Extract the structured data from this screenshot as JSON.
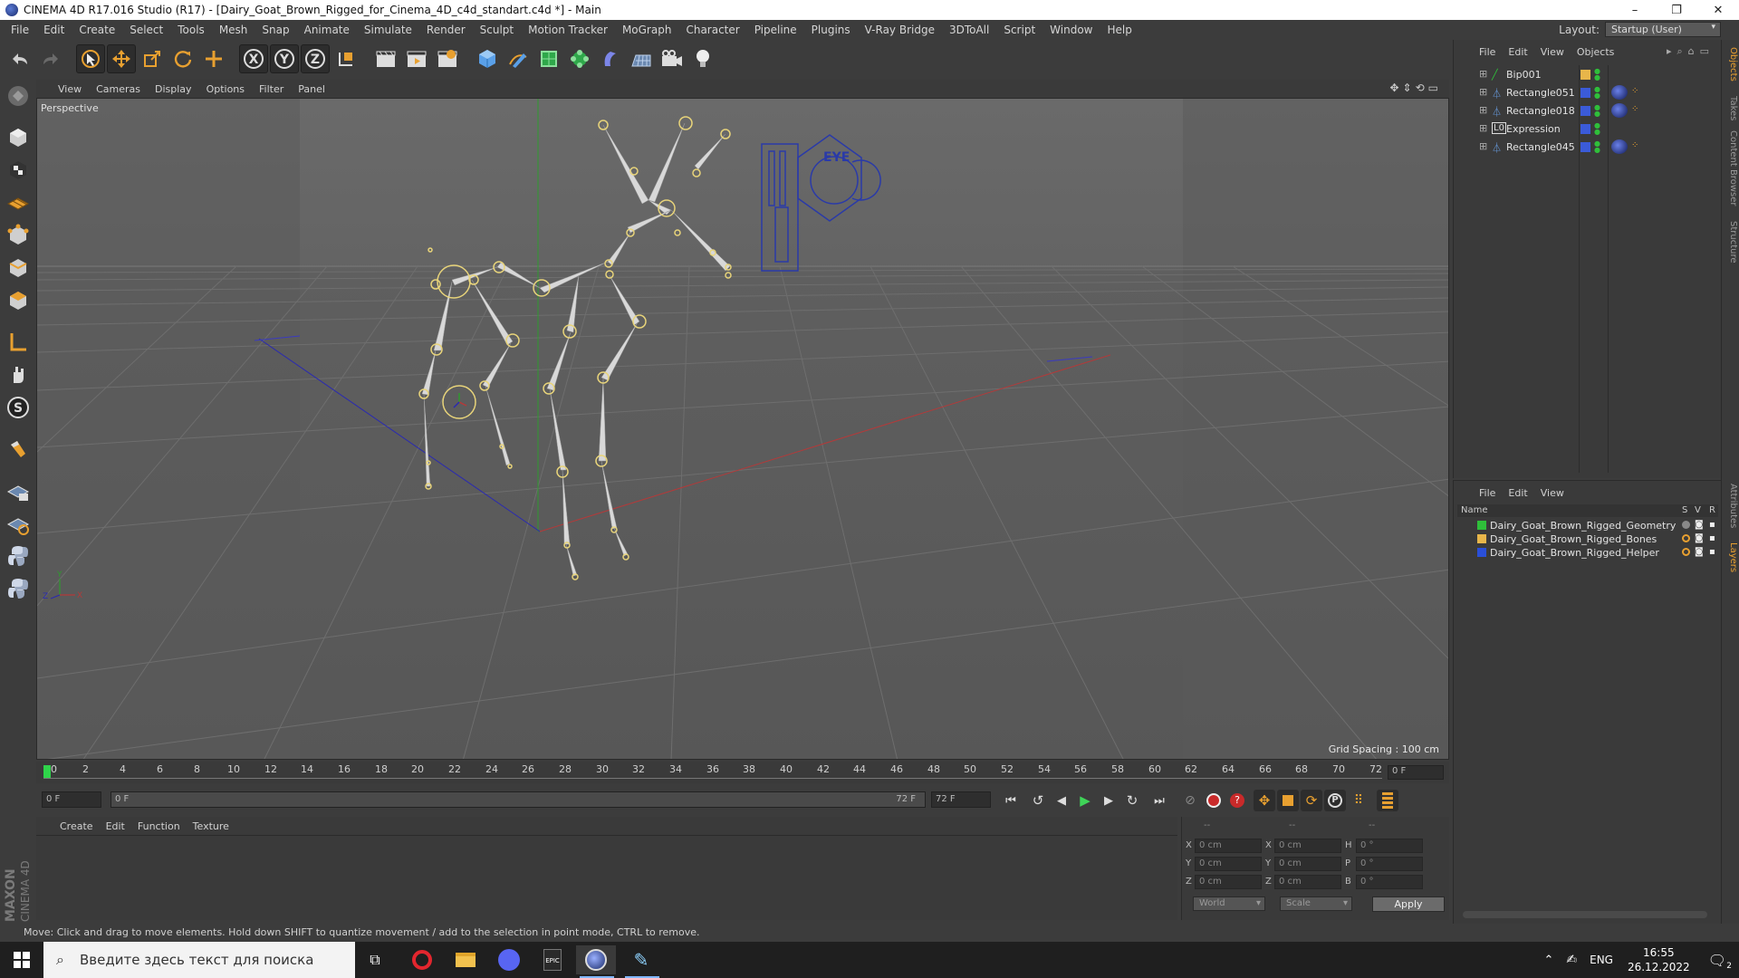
{
  "window": {
    "title": "CINEMA 4D R17.016 Studio (R17) - [Dairy_Goat_Brown_Rigged_for_Cinema_4D_c4d_standart.c4d *] - Main",
    "controls": [
      "–",
      "❐",
      "✕"
    ]
  },
  "menu": [
    "File",
    "Edit",
    "Create",
    "Select",
    "Tools",
    "Mesh",
    "Snap",
    "Animate",
    "Simulate",
    "Render",
    "Sculpt",
    "Motion Tracker",
    "MoGraph",
    "Character",
    "Pipeline",
    "Plugins",
    "V-Ray Bridge",
    "3DToAll",
    "Script",
    "Window",
    "Help"
  ],
  "layout": {
    "label": "Layout:",
    "value": "Startup (User)"
  },
  "toolbar": {
    "axis_x": "X",
    "axis_y": "Y",
    "axis_z": "Z"
  },
  "viewport": {
    "menu": [
      "View",
      "Cameras",
      "Display",
      "Options",
      "Filter",
      "Panel"
    ],
    "camera_label": "Perspective",
    "grid_spacing": "Grid Spacing : 100 cm",
    "eye_text": "EYE"
  },
  "timeline": {
    "ticks": [
      "0",
      "2",
      "4",
      "6",
      "8",
      "10",
      "12",
      "14",
      "16",
      "18",
      "20",
      "22",
      "24",
      "26",
      "28",
      "30",
      "32",
      "34",
      "36",
      "38",
      "40",
      "42",
      "44",
      "46",
      "48",
      "50",
      "52",
      "54",
      "56",
      "58",
      "60",
      "62",
      "64",
      "66",
      "68",
      "70",
      "72"
    ],
    "current_frame": "0 F"
  },
  "playback": {
    "start_field": "0 F",
    "range_start": "0 F",
    "range_end": "72 F",
    "end_field": "72 F"
  },
  "material_panel": {
    "menu": [
      "Create",
      "Edit",
      "Function",
      "Texture"
    ]
  },
  "coords": {
    "header": [
      "--",
      "--",
      "--"
    ],
    "rows": [
      {
        "a_label": "X",
        "a_val": "0 cm",
        "b_label": "X",
        "b_val": "0 cm",
        "c_label": "H",
        "c_val": "0 °"
      },
      {
        "a_label": "Y",
        "a_val": "0 cm",
        "b_label": "Y",
        "b_val": "0 cm",
        "c_label": "P",
        "c_val": "0 °"
      },
      {
        "a_label": "Z",
        "a_val": "0 cm",
        "b_label": "Z",
        "b_val": "0 cm",
        "c_label": "B",
        "c_val": "0 °"
      }
    ],
    "space_dropdown": "World",
    "mode_dropdown": "Scale",
    "apply": "Apply"
  },
  "brand": {
    "maxon": "MAXON",
    "product": "CINEMA 4D"
  },
  "status": "Move: Click and drag to move elements. Hold down SHIFT to quantize movement / add to the selection in point mode, CTRL to remove.",
  "object_manager": {
    "menu": [
      "File",
      "Edit",
      "View",
      "Objects"
    ],
    "objects": [
      {
        "name": "Bip001",
        "color": "#e8b64a"
      },
      {
        "name": "Rectangle051",
        "color": "#3b5bd8"
      },
      {
        "name": "Rectangle018",
        "color": "#3b5bd8"
      },
      {
        "name": "Expression",
        "color": "#3b5bd8"
      },
      {
        "name": "Rectangle045",
        "color": "#3b5bd8"
      }
    ]
  },
  "layer_manager": {
    "menu": [
      "File",
      "Edit",
      "View"
    ],
    "columns": {
      "name": "Name",
      "s": "S",
      "v": "V",
      "r": "R"
    },
    "layers": [
      {
        "name": "Dairy_Goat_Brown_Rigged_Geometry",
        "color": "#2fbf3a"
      },
      {
        "name": "Dairy_Goat_Brown_Rigged_Bones",
        "color": "#e8b64a"
      },
      {
        "name": "Dairy_Goat_Brown_Rigged_Helper",
        "color": "#2a4fd8"
      }
    ]
  },
  "side_tabs": [
    "Objects",
    "Takes",
    "Content Browser",
    "Structure",
    "Attributes",
    "Layers"
  ],
  "taskbar": {
    "search_placeholder": "Введите здесь текст для поиска",
    "lang": "ENG",
    "time": "16:55",
    "date": "26.12.2022",
    "notif_count": "2"
  },
  "colors": {
    "accent_orange": "#e8a030",
    "bone": "#d8d8d8",
    "joint": "#e8d47a",
    "x_axis": "#b33a3a",
    "y_axis": "#2f9a2f",
    "z_axis": "#2a2ab0"
  }
}
